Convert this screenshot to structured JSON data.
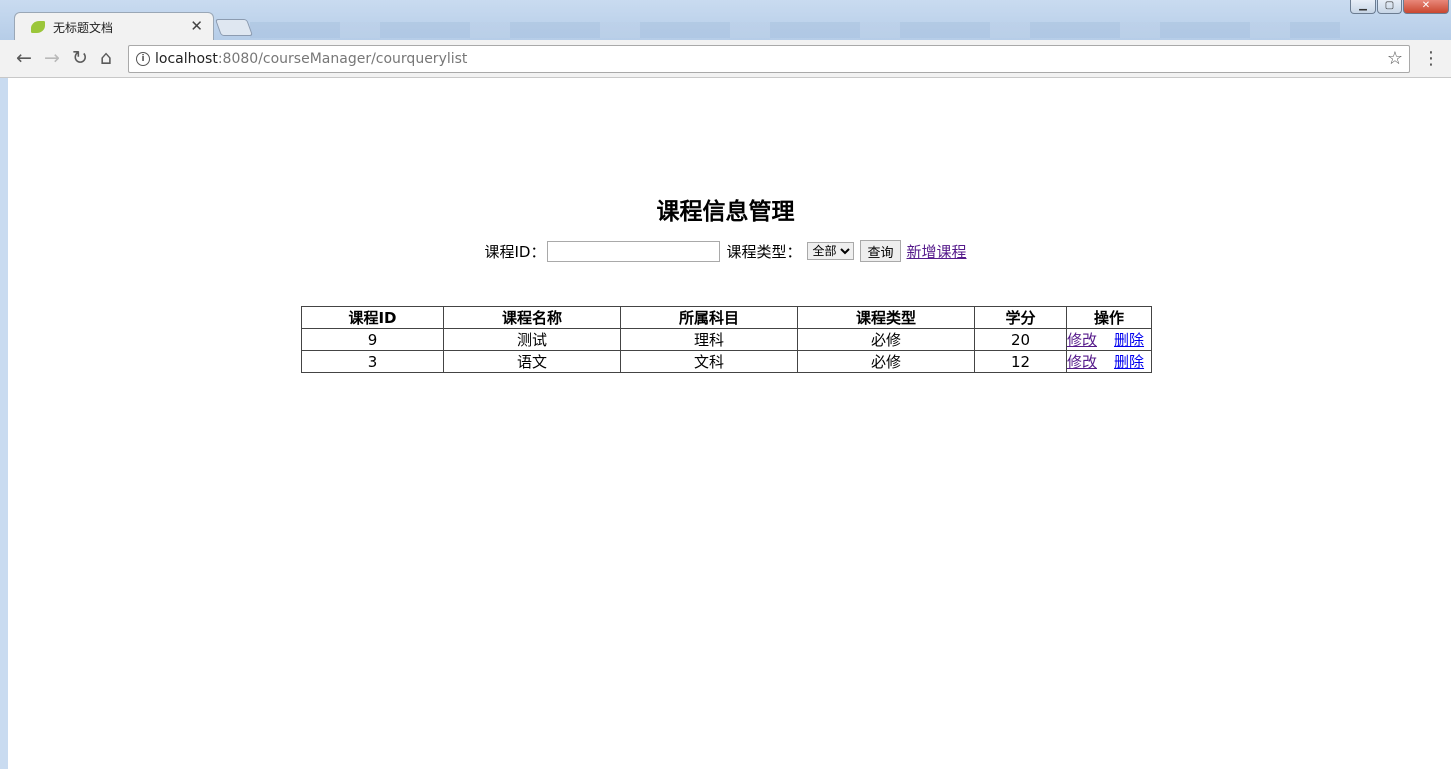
{
  "browser": {
    "tab_title": "无标题文档",
    "tab_close": "✕",
    "url_host": "localhost",
    "url_rest": ":8080/courseManager/courquerylist",
    "icons": [
      "back-arrow-icon",
      "forward-arrow-icon",
      "reload-icon",
      "home-icon",
      "info-icon",
      "star-icon",
      "menu-icon"
    ]
  },
  "page": {
    "title": "课程信息管理"
  },
  "search": {
    "id_label": "课程ID：",
    "id_value": "",
    "type_label": "课程类型：",
    "type_selected": "全部",
    "query_button": "查询",
    "add_link": "新增课程"
  },
  "table": {
    "headers": [
      "课程ID",
      "课程名称",
      "所属科目",
      "课程类型",
      "学分",
      "操作"
    ],
    "rows": [
      {
        "id": "9",
        "name": "测试",
        "subject": "理科",
        "type": "必修",
        "credit": "20",
        "edit": "修改",
        "delete": "删除"
      },
      {
        "id": "3",
        "name": "语文",
        "subject": "文科",
        "type": "必修",
        "credit": "12",
        "edit": "修改",
        "delete": "删除"
      }
    ]
  },
  "colors": {
    "visited_link": "#551a8b",
    "unvisited_link": "#0000ee",
    "border": "#444444"
  }
}
